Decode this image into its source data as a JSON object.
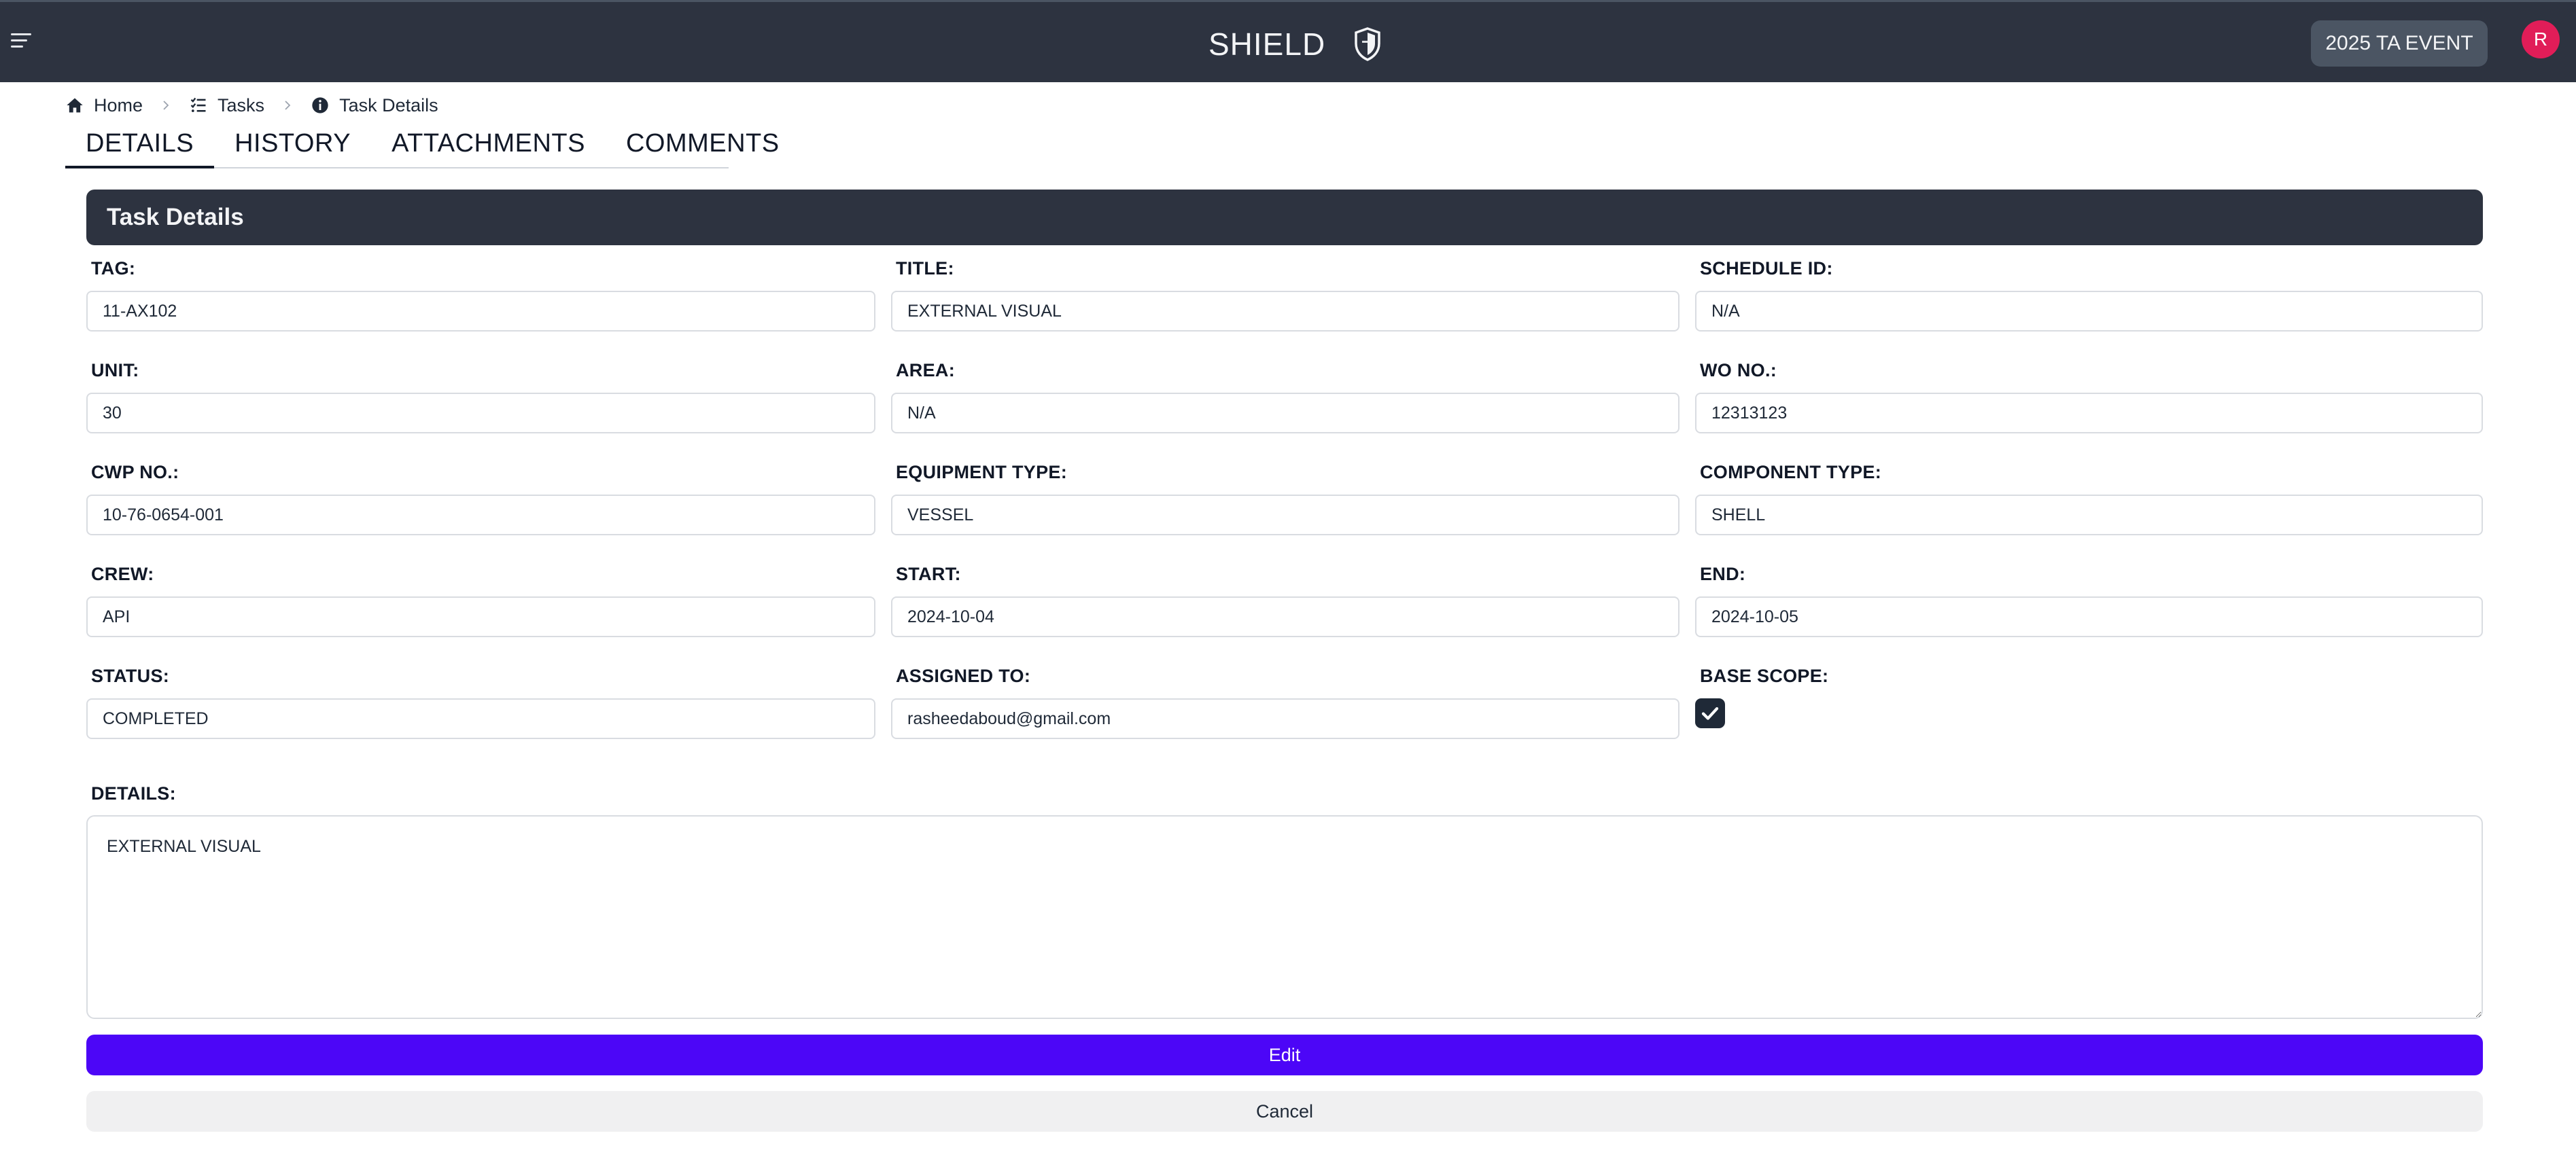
{
  "header": {
    "app_title": "SHIELD",
    "event_button": "2025 TA EVENT",
    "avatar_initial": "R"
  },
  "breadcrumb": [
    {
      "label": "Home",
      "icon": "home-icon"
    },
    {
      "label": "Tasks",
      "icon": "task-list-icon"
    },
    {
      "label": "Task Details",
      "icon": "info-icon"
    }
  ],
  "tabs": [
    "DETAILS",
    "HISTORY",
    "ATTACHMENTS",
    "COMMENTS"
  ],
  "active_tab": "DETAILS",
  "panel": {
    "title": "Task Details"
  },
  "fields": {
    "tag": {
      "label": "TAG:",
      "value": "11-AX102"
    },
    "title": {
      "label": "TITLE:",
      "value": "EXTERNAL VISUAL"
    },
    "schedule_id": {
      "label": "SCHEDULE ID:",
      "value": "N/A"
    },
    "unit": {
      "label": "UNIT:",
      "value": "30"
    },
    "area": {
      "label": "AREA:",
      "value": "N/A"
    },
    "wo_no": {
      "label": "WO NO.:",
      "value": "12313123"
    },
    "cwp_no": {
      "label": "CWP NO.:",
      "value": "10-76-0654-001"
    },
    "equipment_type": {
      "label": "EQUIPMENT TYPE:",
      "value": "VESSEL"
    },
    "component_type": {
      "label": "COMPONENT TYPE:",
      "value": "SHELL"
    },
    "crew": {
      "label": "CREW:",
      "value": "API"
    },
    "start": {
      "label": "START:",
      "value": "2024-10-04"
    },
    "end": {
      "label": "END:",
      "value": "2024-10-05"
    },
    "status": {
      "label": "STATUS:",
      "value": "COMPLETED"
    },
    "assigned_to": {
      "label": "ASSIGNED TO:",
      "value": "rasheedaboud@gmail.com"
    },
    "base_scope": {
      "label": "BASE SCOPE:",
      "checked": true
    },
    "details": {
      "label": "DETAILS:",
      "value": "EXTERNAL VISUAL"
    }
  },
  "actions": {
    "edit": "Edit",
    "cancel": "Cancel"
  },
  "colors": {
    "header_bg": "#2d3340",
    "edit_button": "#4c06f7",
    "avatar": "#e11d58",
    "event_button": "#4b5563"
  }
}
